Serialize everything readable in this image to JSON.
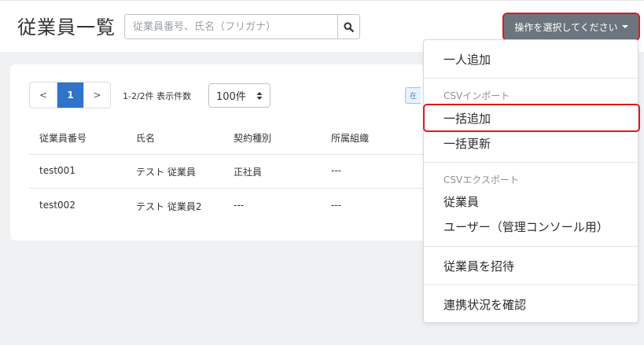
{
  "header": {
    "title": "従業員一覧",
    "search_placeholder": "従業員番号、氏名（フリガナ）",
    "ops_button_label": "操作を選択してください"
  },
  "pagination": {
    "prev": "<",
    "current": "1",
    "next": ">"
  },
  "list_meta": {
    "count_text": "1-2/2件  表示件数",
    "per_page_value": "100件",
    "partial_tag": "在"
  },
  "table": {
    "columns": [
      "従業員番号",
      "氏名",
      "契約種別",
      "所属組織"
    ],
    "rows": [
      [
        "test001",
        "テスト 従業員",
        "正社員",
        "---"
      ],
      [
        "test002",
        "テスト 従業員2",
        "---",
        "---"
      ]
    ]
  },
  "dropdown": {
    "item_add_single": "一人追加",
    "csv_import_header": "CSVインポート",
    "item_bulk_add": "一括追加",
    "item_bulk_update": "一括更新",
    "csv_export_header": "CSVエクスポート",
    "item_export_employees": "従業員",
    "item_export_users": "ユーザー（管理コンソール用）",
    "item_invite": "従業員を招待",
    "item_check_sync": "連携状況を確認"
  },
  "colors": {
    "accent": "#2f74c8",
    "ops_button_bg": "#6c757d",
    "highlight": "#e0181e"
  }
}
